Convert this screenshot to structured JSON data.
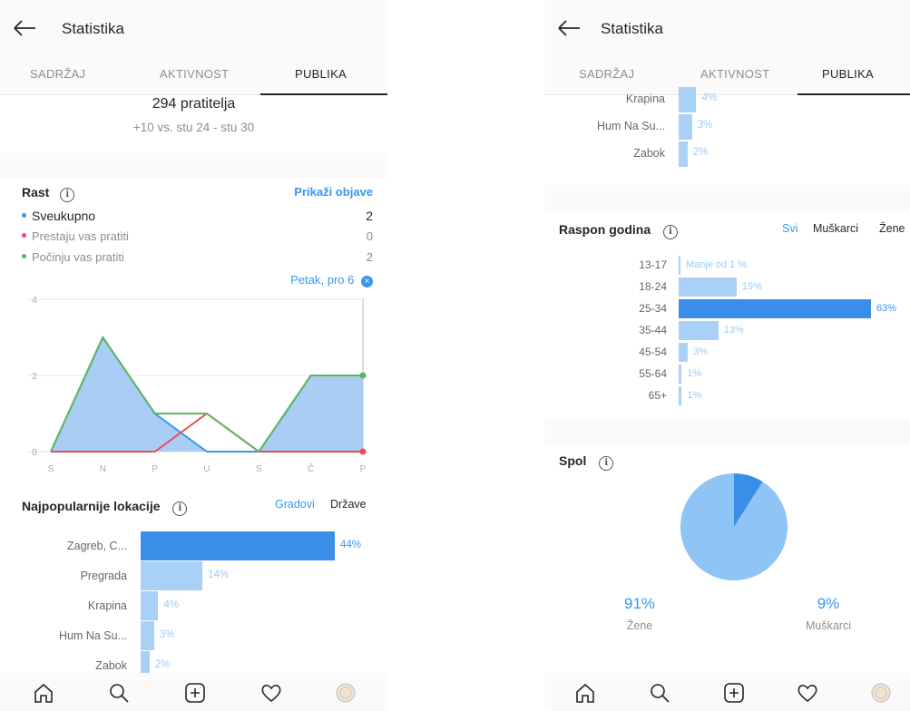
{
  "colors": {
    "accent": "#3897f0",
    "bar_top": "#3b8ee8",
    "bar_other": "#a9d0f7",
    "green": "#5cb85c",
    "red": "#ed4956",
    "area": "#aacdf5"
  },
  "header": {
    "title": "Statistika"
  },
  "tabs": [
    {
      "label": "SADRŽAJ"
    },
    {
      "label": "AKTIVNOST"
    },
    {
      "label": "PUBLIKA",
      "active": true
    }
  ],
  "left": {
    "followers": {
      "count": "294 pratitelja",
      "change": "+10 vs. stu 24 - stu 30"
    },
    "growth": {
      "title": "Rast",
      "link": "Prikaži objave",
      "rows": [
        {
          "label": "Sveukupno",
          "value": "2",
          "color": "#3897f0"
        },
        {
          "label": "Prestaju vas pratiti",
          "value": "0",
          "color": "#ed4956"
        },
        {
          "label": "Počinju vas pratiti",
          "value": "2",
          "color": "#5cb85c"
        }
      ],
      "selected_day": "Petak, pro 6"
    },
    "locations": {
      "title": "Najpopularnije lokacije",
      "filters": [
        "Gradovi",
        "Države"
      ],
      "items": [
        {
          "label": "Zagreb, C...",
          "pct": "44%",
          "value": 44
        },
        {
          "label": "Pregrada",
          "pct": "14%",
          "value": 14
        },
        {
          "label": "Krapina",
          "pct": "4%",
          "value": 4
        },
        {
          "label": "Hum Na Su...",
          "pct": "3%",
          "value": 3
        },
        {
          "label": "Zabok",
          "pct": "2%",
          "value": 2
        }
      ]
    }
  },
  "chart_data": {
    "type": "line",
    "categories": [
      "S",
      "N",
      "P",
      "U",
      "S",
      "Č",
      "P"
    ],
    "ylim": [
      0,
      4
    ],
    "yticks": [
      "0",
      "2",
      "4"
    ],
    "series": [
      {
        "name": "Sveukupno",
        "values": [
          0,
          3,
          1,
          0,
          0,
          2,
          2
        ]
      },
      {
        "name": "Prestaju vas pratiti",
        "values": [
          0,
          0,
          0,
          1,
          0,
          0,
          0
        ]
      },
      {
        "name": "Počinju vas pratiti",
        "values": [
          0,
          3,
          1,
          1,
          0,
          2,
          2
        ]
      }
    ]
  },
  "right": {
    "locations_tail": [
      {
        "label": "Krapina",
        "pct": "4%",
        "value": 4
      },
      {
        "label": "Hum Na Su...",
        "pct": "3%",
        "value": 3
      },
      {
        "label": "Zabok",
        "pct": "2%",
        "value": 2
      }
    ],
    "age": {
      "title": "Raspon godina",
      "filters": [
        "Svi",
        "Muškarci",
        "Žene"
      ],
      "items": [
        {
          "label": "13-17",
          "pct": "Manje od 1 %",
          "value": 0
        },
        {
          "label": "18-24",
          "pct": "19%",
          "value": 19
        },
        {
          "label": "25-34",
          "pct": "63%",
          "value": 63
        },
        {
          "label": "35-44",
          "pct": "13%",
          "value": 13
        },
        {
          "label": "45-54",
          "pct": "3%",
          "value": 3
        },
        {
          "label": "55-64",
          "pct": "1%",
          "value": 1
        },
        {
          "label": "65+",
          "pct": "1%",
          "value": 1
        }
      ]
    },
    "gender": {
      "title": "Spol",
      "female": {
        "pct": "91%",
        "label": "Žene",
        "value": 91
      },
      "male": {
        "pct": "9%",
        "label": "Muškarci",
        "value": 9
      }
    }
  },
  "nav": [
    "home-icon",
    "search-icon",
    "add-icon",
    "heart-icon",
    "profile-avatar"
  ]
}
